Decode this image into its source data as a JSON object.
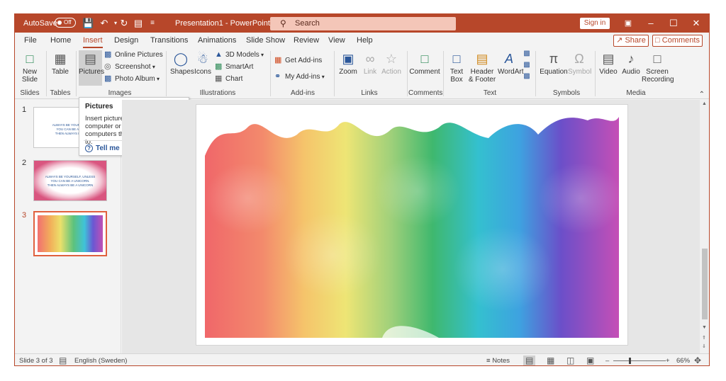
{
  "titlebar": {
    "autosave_label": "AutoSave",
    "autosave_state": "Off",
    "doc_title": "Presentation1 - PowerPoint",
    "search_placeholder": "Search",
    "signin_label": "Sign in",
    "accent_color": "#b7472a"
  },
  "menu": {
    "tabs": [
      "File",
      "Home",
      "Insert",
      "Design",
      "Transitions",
      "Animations",
      "Slide Show",
      "Review",
      "View",
      "Help"
    ],
    "active_tab": "Insert",
    "share_label": "Share",
    "comments_label": "Comments"
  },
  "ribbon": {
    "new_slide": "New Slide",
    "table": "Table",
    "pictures": "Pictures",
    "online_pictures": "Online Pictures",
    "screenshot": "Screenshot",
    "photo_album": "Photo Album",
    "shapes": "Shapes",
    "icons": "Icons",
    "models_3d": "3D Models",
    "smartart": "SmartArt",
    "chart": "Chart",
    "get_addins": "Get Add-ins",
    "my_addins": "My Add-ins",
    "zoom": "Zoom",
    "link": "Link",
    "action": "Action",
    "comment": "Comment",
    "text_box": "Text Box",
    "header_footer": "Header & Footer",
    "wordart": "WordArt",
    "equation": "Equation",
    "symbol": "Symbol",
    "video": "Video",
    "audio": "Audio",
    "screen_recording": "Screen Recording",
    "groups": [
      "Slides",
      "Tables",
      "Images",
      "Illustrations",
      "Add-ins",
      "Links",
      "Comments",
      "Text",
      "Symbols",
      "Media"
    ]
  },
  "tooltip": {
    "title": "Pictures",
    "description": "Insert pictures from your computer or from other computers that you're connected to.",
    "more": "Tell me more"
  },
  "thumbnails": [
    {
      "number": "1",
      "lines": [
        "ALWAYS BE YOURSELF",
        "YOU CAN BE A UN",
        "THEN ALWAYS BE A"
      ]
    },
    {
      "number": "2",
      "lines": [
        "ALWAYS BE YOURSELF, UNLESS",
        "YOU CAN BE A UNICORN.",
        "THEN ALWAYS BE A UNICORN"
      ]
    },
    {
      "number": "3",
      "lines": []
    }
  ],
  "statusbar": {
    "slide_info": "Slide 3 of 3",
    "language": "English (Sweden)",
    "notes": "Notes",
    "zoom_level": "66%"
  }
}
